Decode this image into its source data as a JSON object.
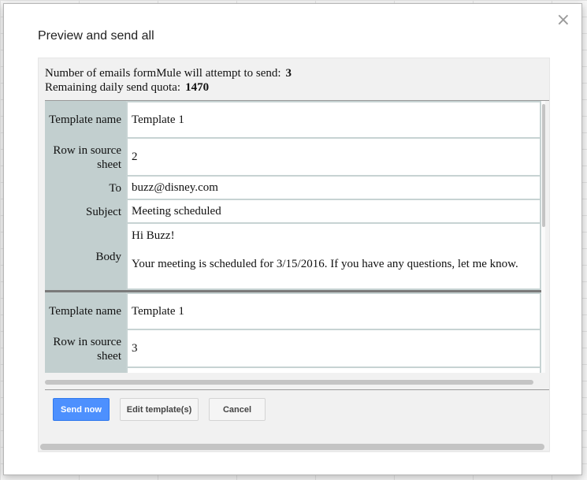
{
  "dialog": {
    "title": "Preview and send all",
    "close_icon": "×"
  },
  "summary": {
    "attempt_label": "Number of emails formMule will attempt to send:",
    "attempt_count": "3",
    "quota_label": "Remaining daily send quota:",
    "quota_count": "1470"
  },
  "labels": {
    "template_name": "Template name",
    "row_in_source": "Row in source sheet",
    "to": "To",
    "subject": "Subject",
    "body": "Body"
  },
  "emails": [
    {
      "template_name": "Template 1",
      "row": "2",
      "to": "buzz@disney.com",
      "subject": "Meeting scheduled",
      "body_greeting": "Hi Buzz!",
      "body_text": "Your meeting is scheduled for 3/15/2016. If you have any questions, let me know."
    },
    {
      "template_name": "Template 1",
      "row": "3"
    }
  ],
  "buttons": {
    "send_now": "Send now",
    "edit_templates": "Edit template(s)",
    "cancel": "Cancel"
  },
  "colors": {
    "primary": "#4d90fe",
    "label_bg": "#c2cfcf"
  }
}
